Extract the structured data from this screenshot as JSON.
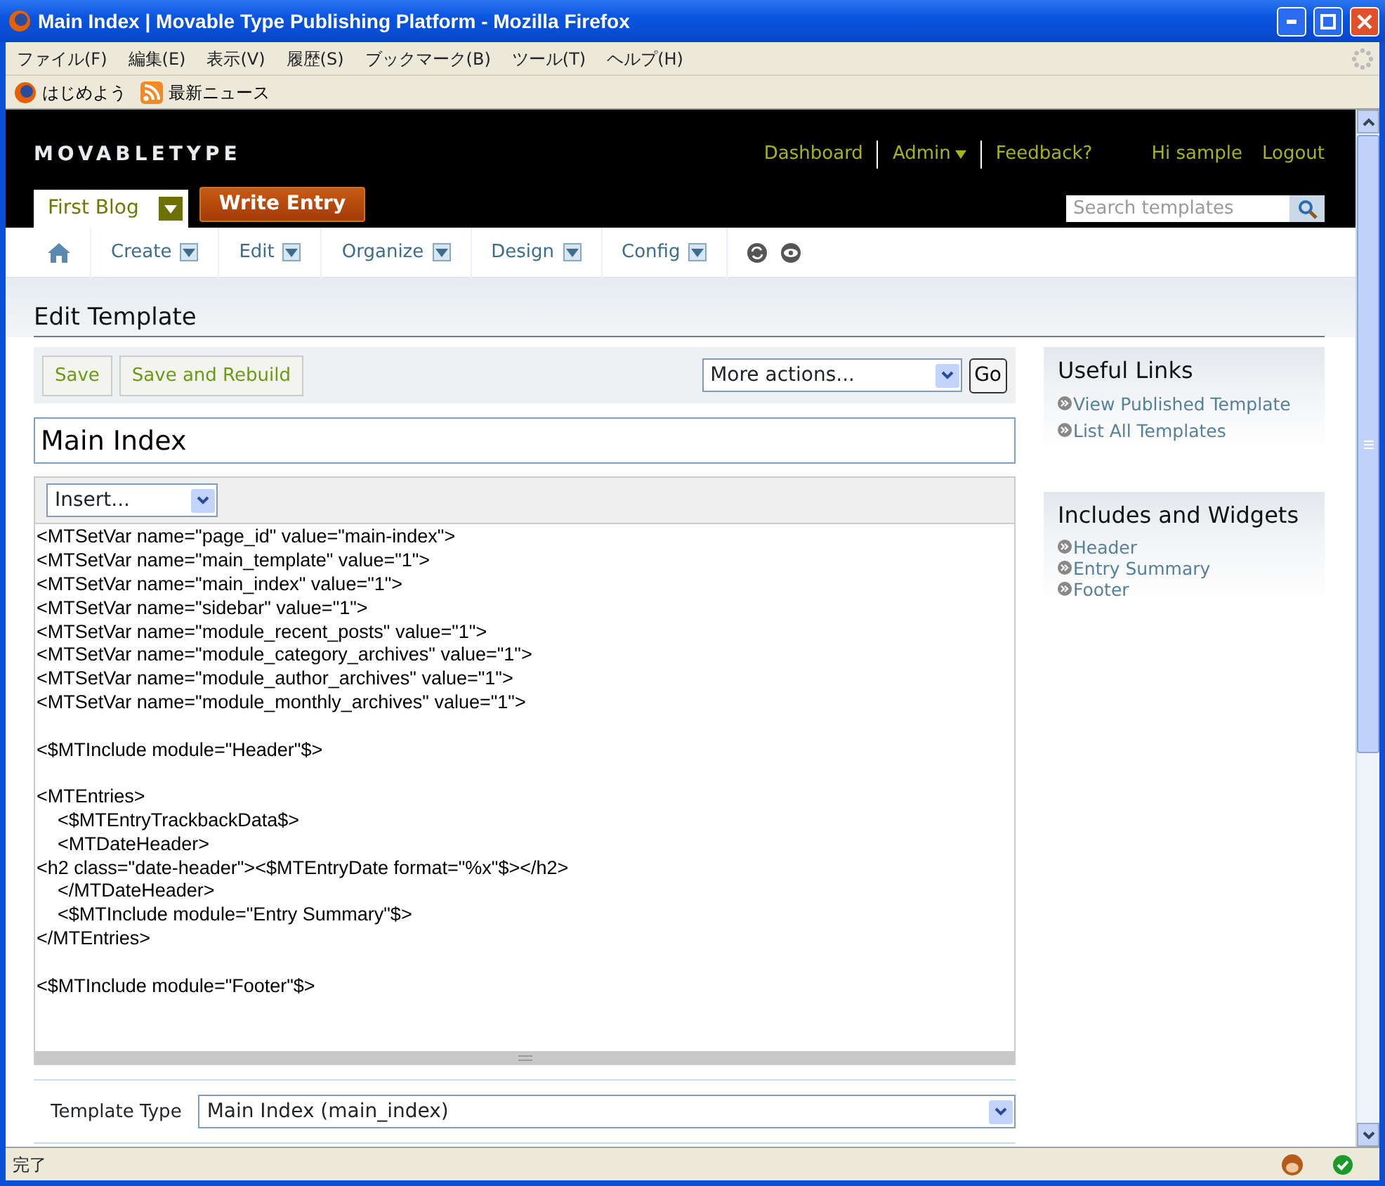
{
  "window": {
    "title": "Main Index | Movable Type Publishing Platform - Mozilla Firefox"
  },
  "menu": [
    "ファイル(F)",
    "編集(E)",
    "表示(V)",
    "履歴(S)",
    "ブックマーク(B)",
    "ツール(T)",
    "ヘルプ(H)"
  ],
  "bookmarks": [
    {
      "label": "はじめよう",
      "kind": "firefox"
    },
    {
      "label": "最新ニュース",
      "kind": "feed"
    }
  ],
  "header": {
    "logo": "MOVABLETYPE",
    "links": [
      {
        "label": "Dashboard",
        "kind": "link"
      },
      {
        "label": "Admin",
        "kind": "dropdown"
      },
      {
        "label": "Feedback?",
        "kind": "link"
      }
    ],
    "user": "Hi sample",
    "logout": "Logout",
    "blog": "First Blog",
    "write_entry": "Write Entry",
    "search": {
      "placeholder": "Search templates"
    }
  },
  "nav": [
    {
      "label": "Create"
    },
    {
      "label": "Edit"
    },
    {
      "label": "Organize"
    },
    {
      "label": "Design"
    },
    {
      "label": "Config"
    }
  ],
  "page_title": "Edit Template",
  "actions": {
    "buttons": [
      "Save",
      "Save and Rebuild"
    ],
    "more": "More actions...",
    "go": "Go"
  },
  "template_name": "Main Index",
  "insert": "Insert...",
  "code": [
    [
      "<MTSetVar name=\"page_id\" value=\"main-index\">",
      "<MTSetVar name=\"main_template\" value=\"1\">",
      "<MTSetVar name=\"main_index\" value=\"1\">",
      "<MTSetVar name=\"sidebar\" value=\"1\">",
      "<MTSetVar name=\"module_recent_posts\" value=\"1\">",
      "<MTSetVar name=\"module_category_archives\" value=\"1\">",
      "<MTSetVar name=\"module_author_archives\" value=\"1\">",
      "<MTSetVar name=\"module_monthly_archives\" value=\"1\">"
    ],
    [
      "<$MTInclude module=\"Header\"$>"
    ],
    [
      "<MTEntries>",
      "    <$MTEntryTrackbackData$>",
      "    <MTDateHeader>",
      "<h2 class=\"date-header\"><$MTEntryDate format=\"%x\"$></h2>",
      "    </MTDateHeader>",
      "    <$MTInclude module=\"Entry Summary\"$>",
      "</MTEntries>"
    ],
    [
      "<$MTInclude module=\"Footer\"$>"
    ]
  ],
  "template_type": {
    "label": "Template Type",
    "value": "Main Index (main_index)"
  },
  "sidebar": [
    {
      "title": "Useful Links",
      "links": [
        "View Published Template",
        "List All Templates"
      ]
    },
    {
      "title": "Includes and Widgets",
      "links": [
        "Header",
        "Entry Summary",
        "Footer"
      ]
    }
  ],
  "status_bar": "完了"
}
